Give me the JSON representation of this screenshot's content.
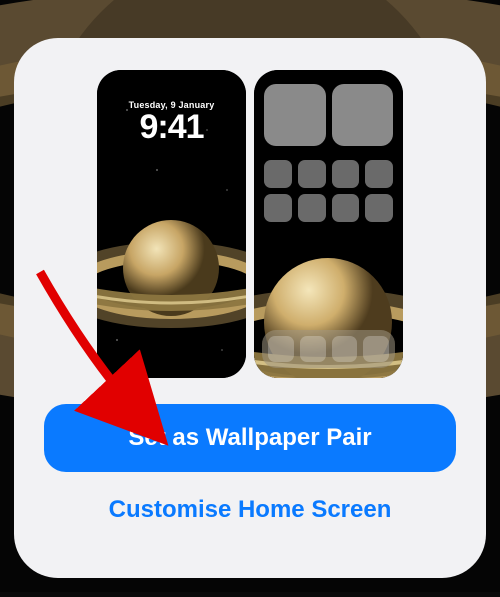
{
  "lock": {
    "date": "Tuesday, 9 January",
    "time": "9:41"
  },
  "buttons": {
    "primary": "Set as Wallpaper Pair",
    "secondary": "Customise Home Screen"
  },
  "colors": {
    "accent": "#0a7aff"
  }
}
